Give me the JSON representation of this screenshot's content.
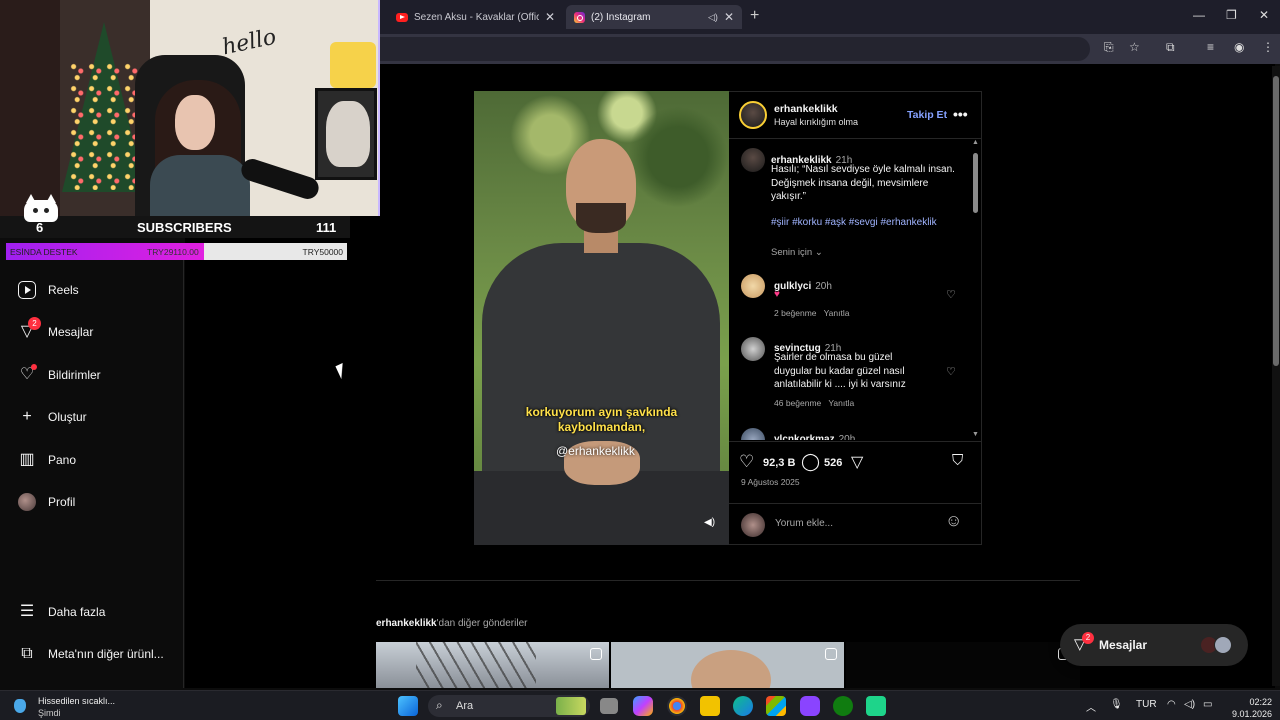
{
  "browser": {
    "tabs": [
      {
        "title": "Sezen Aksu - Kavaklar (Official V"
      },
      {
        "title": "(2) Instagram"
      }
    ]
  },
  "stream": {
    "left_count": "6",
    "label": "SUBSCRIBERS",
    "right_count": "111",
    "goal": {
      "label": "ESİNDA DESTEK",
      "current": "TRY29110.00",
      "target": "TRY50000",
      "progress": 0.58
    },
    "sign_text": "hello"
  },
  "nav": {
    "items": [
      {
        "label": "Reels"
      },
      {
        "label": "Mesajlar",
        "badge": "2"
      },
      {
        "label": "Bildirimler"
      },
      {
        "label": "Oluştur"
      },
      {
        "label": "Pano"
      },
      {
        "label": "Profil"
      },
      {
        "label": "Daha fazla"
      },
      {
        "label": "Meta'nın diğer ürünl..."
      }
    ]
  },
  "post": {
    "username": "erhankeklikk",
    "subtitle": "Hayal kırıklığım olma",
    "follow_label": "Takip Et",
    "caption_time": "21h",
    "caption_lines": [
      "Hasılı; “Nasıl sevdiyse öyle kalmalı insan.",
      "Değişmek insana değil, mevsimlere",
      "yakışır.”"
    ],
    "hashtags": "#şiir #korku #aşk #sevgi #erhankeklik",
    "for_you": "Senin için",
    "video_caption_1": "korkuyorum ayın şavkında",
    "video_caption_2": "kaybolmandan,",
    "watermark": "@erhankeklikk",
    "comments": [
      {
        "user": "gulklyci",
        "time": "20h",
        "text": "♥",
        "likes": "2 beğenme",
        "reply": "Yanıtla"
      },
      {
        "user": "sevinctug",
        "time": "21h",
        "lines": [
          "Şairler de olmasa bu güzel",
          "duygular bu kadar güzel nasıl",
          "anlatılabilir ki .... iyi ki varsınız"
        ],
        "likes": "46 beğenme",
        "reply": "Yanıtla"
      },
      {
        "user": "ylcnkorkmaz",
        "time": "20h"
      }
    ],
    "likes": "92,3 B",
    "comment_count": "526",
    "date": "9 Ağustos 2025",
    "comment_placeholder": "Yorum ekle..."
  },
  "more_posts": {
    "user": "erhankeklikk",
    "suffix": "'dan diğer gönderiler"
  },
  "messages_pill": {
    "label": "Mesajlar",
    "badge": "2"
  },
  "taskbar": {
    "weather_1": "Hissedilen sıcaklı...",
    "weather_2": "Şimdi",
    "search": "Ara",
    "lang": "TUR",
    "time": "02:22",
    "date": "9.01.2026"
  }
}
